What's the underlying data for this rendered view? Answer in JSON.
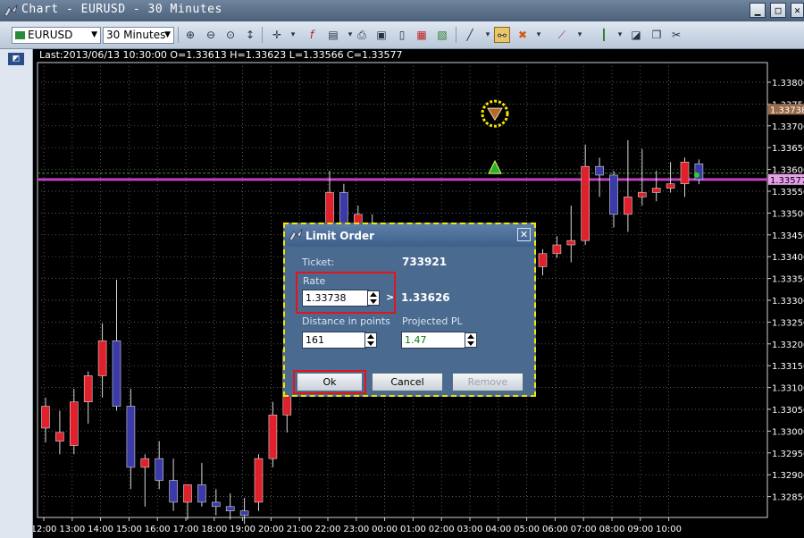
{
  "window": {
    "title": "Chart - EURUSD - 30 Minutes"
  },
  "toolbar": {
    "symbol": "EURUSD",
    "timeframe": "30 Minutes"
  },
  "chart": {
    "last_info": "Last:2013/06/13 10:30:00 O=1.33613 H=1.33623 L=1.33566 C=1.33577",
    "current_price_label": "1.33577",
    "limit_price_label": "1.33738",
    "y_tick_labels": [
      "1.33800",
      "1.33750",
      "1.33700",
      "1.33650",
      "1.33600",
      "1.33550",
      "1.33500",
      "1.33450",
      "1.33400",
      "1.33350",
      "1.33300",
      "1.33250",
      "1.33200",
      "1.33150",
      "1.33100",
      "1.33050",
      "1.33000",
      "1.32950",
      "1.32900",
      "1.32850"
    ],
    "x_tick_labels": [
      "12:00",
      "13:00",
      "14:00",
      "15:00",
      "16:00",
      "17:00",
      "18:00",
      "19:00",
      "20:00",
      "21:00",
      "22:00",
      "23:00",
      "00:00",
      "01:00",
      "02:00",
      "03:00",
      "04:00",
      "05:00",
      "06:00",
      "07:00",
      "08:00",
      "09:00",
      "10:00"
    ],
    "colors": {
      "up_candle": "#e0202a",
      "down_candle": "#3a3aa8",
      "current_price_line": "#c040c0",
      "grid": "#7a7a7a"
    }
  },
  "chart_data": {
    "type": "candlestick",
    "title": "",
    "y_ticks": [
      1.338,
      1.3375,
      1.337,
      1.3365,
      1.336,
      1.3355,
      1.335,
      1.3345,
      1.334,
      1.3335,
      1.333,
      1.3325,
      1.332,
      1.3315,
      1.331,
      1.3305,
      1.33,
      1.3295,
      1.329,
      1.3285
    ],
    "ylim": [
      1.3281,
      1.3383
    ],
    "grid": true,
    "x_ticks": [
      "12:00",
      "13:00",
      "14:00",
      "15:00",
      "16:00",
      "17:00",
      "18:00",
      "19:00",
      "20:00",
      "21:00",
      "22:00",
      "23:00",
      "00:00",
      "01:00",
      "02:00",
      "03:00",
      "04:00",
      "05:00",
      "06:00",
      "07:00",
      "08:00",
      "09:00",
      "10:00"
    ],
    "candles": [
      {
        "o": 1.33007,
        "h": 1.33077,
        "l": 1.32974,
        "c": 1.33057
      },
      {
        "o": 1.32977,
        "h": 1.33047,
        "l": 1.32947,
        "c": 1.32997
      },
      {
        "o": 1.32967,
        "h": 1.33097,
        "l": 1.32947,
        "c": 1.33067
      },
      {
        "o": 1.33067,
        "h": 1.33137,
        "l": 1.33017,
        "c": 1.33127
      },
      {
        "o": 1.33127,
        "h": 1.33247,
        "l": 1.33077,
        "c": 1.33207
      },
      {
        "o": 1.33207,
        "h": 1.33347,
        "l": 1.33047,
        "c": 1.33057
      },
      {
        "o": 1.33057,
        "h": 1.33097,
        "l": 1.32867,
        "c": 1.32917
      },
      {
        "o": 1.32917,
        "h": 1.32947,
        "l": 1.32827,
        "c": 1.32937
      },
      {
        "o": 1.32937,
        "h": 1.32977,
        "l": 1.32867,
        "c": 1.32887
      },
      {
        "o": 1.32887,
        "h": 1.32937,
        "l": 1.32817,
        "c": 1.32837
      },
      {
        "o": 1.32837,
        "h": 1.32877,
        "l": 1.32797,
        "c": 1.32877
      },
      {
        "o": 1.32877,
        "h": 1.32927,
        "l": 1.32827,
        "c": 1.32837
      },
      {
        "o": 1.32837,
        "h": 1.32867,
        "l": 1.32807,
        "c": 1.32827
      },
      {
        "o": 1.32827,
        "h": 1.32857,
        "l": 1.32797,
        "c": 1.32817
      },
      {
        "o": 1.32817,
        "h": 1.32847,
        "l": 1.32787,
        "c": 1.32807
      },
      {
        "o": 1.32837,
        "h": 1.32947,
        "l": 1.32817,
        "c": 1.32937
      },
      {
        "o": 1.32937,
        "h": 1.33067,
        "l": 1.32917,
        "c": 1.33037
      },
      {
        "o": 1.33037,
        "h": 1.33207,
        "l": 1.32997,
        "c": 1.33187
      },
      {
        "o": 1.33187,
        "h": 1.33337,
        "l": 1.33157,
        "c": 1.33317
      },
      {
        "o": 1.33317,
        "h": 1.33467,
        "l": 1.33297,
        "c": 1.33447
      },
      {
        "o": 1.33447,
        "h": 1.33597,
        "l": 1.33407,
        "c": 1.33547
      },
      {
        "o": 1.33547,
        "h": 1.33567,
        "l": 1.33447,
        "c": 1.33477
      },
      {
        "o": 1.33477,
        "h": 1.33517,
        "l": 1.33437,
        "c": 1.33497
      },
      {
        "o": 1.33477,
        "h": 1.33497,
        "l": 1.33447,
        "c": 1.33467
      },
      {
        "o": 1.33437,
        "h": 1.33467,
        "l": 1.33397,
        "c": 1.33417
      },
      {
        "o": 1.33417,
        "h": 1.33447,
        "l": 1.33377,
        "c": 1.33397
      },
      {
        "o": 1.33397,
        "h": 1.33427,
        "l": 1.33367,
        "c": 1.33377
      },
      {
        "o": 1.33377,
        "h": 1.33407,
        "l": 1.33347,
        "c": 1.33387
      },
      {
        "o": 1.33387,
        "h": 1.33417,
        "l": 1.33357,
        "c": 1.33377
      },
      {
        "o": 1.33377,
        "h": 1.33397,
        "l": 1.33337,
        "c": 1.33357
      },
      {
        "o": 1.33357,
        "h": 1.33397,
        "l": 1.33327,
        "c": 1.33387
      },
      {
        "o": 1.33357,
        "h": 1.33407,
        "l": 1.33337,
        "c": 1.33397
      },
      {
        "o": 1.33347,
        "h": 1.33417,
        "l": 1.33337,
        "c": 1.33407
      },
      {
        "o": 1.33367,
        "h": 1.33397,
        "l": 1.33347,
        "c": 1.33357
      },
      {
        "o": 1.33347,
        "h": 1.33387,
        "l": 1.33337,
        "c": 1.33377
      },
      {
        "o": 1.33377,
        "h": 1.33417,
        "l": 1.33357,
        "c": 1.33407
      },
      {
        "o": 1.33407,
        "h": 1.33447,
        "l": 1.33397,
        "c": 1.33427
      },
      {
        "o": 1.33427,
        "h": 1.33517,
        "l": 1.33387,
        "c": 1.33437
      },
      {
        "o": 1.33437,
        "h": 1.33657,
        "l": 1.33427,
        "c": 1.33607
      },
      {
        "o": 1.33607,
        "h": 1.33627,
        "l": 1.33537,
        "c": 1.33587
      },
      {
        "o": 1.33587,
        "h": 1.33597,
        "l": 1.33467,
        "c": 1.33497
      },
      {
        "o": 1.33497,
        "h": 1.33667,
        "l": 1.33457,
        "c": 1.33537
      },
      {
        "o": 1.33537,
        "h": 1.33647,
        "l": 1.33517,
        "c": 1.33547
      },
      {
        "o": 1.33547,
        "h": 1.33597,
        "l": 1.33527,
        "c": 1.33557
      },
      {
        "o": 1.33557,
        "h": 1.33617,
        "l": 1.33547,
        "c": 1.33567
      },
      {
        "o": 1.33567,
        "h": 1.33627,
        "l": 1.33537,
        "c": 1.33617
      },
      {
        "o": 1.33613,
        "h": 1.33623,
        "l": 1.33566,
        "c": 1.33577
      }
    ],
    "current_price": 1.33577,
    "limit_price": 1.33738,
    "limit_marker_price": 1.33728,
    "triangle_marker_price": 1.33605
  },
  "dialog": {
    "title": "Limit Order",
    "ticket_label": "Ticket:",
    "ticket_value": "733921",
    "rate_label": "Rate",
    "rate_value": "1.33738",
    "rate_arrow": ">",
    "market_rate": "1.33626",
    "distance_label": "Distance in points",
    "distance_value": "161",
    "pl_label": "Projected PL",
    "pl_value": "1.47",
    "ok_label": "Ok",
    "cancel_label": "Cancel",
    "remove_label": "Remove",
    "close_symbol": "✕",
    "pl_color": "#0f7a12"
  }
}
